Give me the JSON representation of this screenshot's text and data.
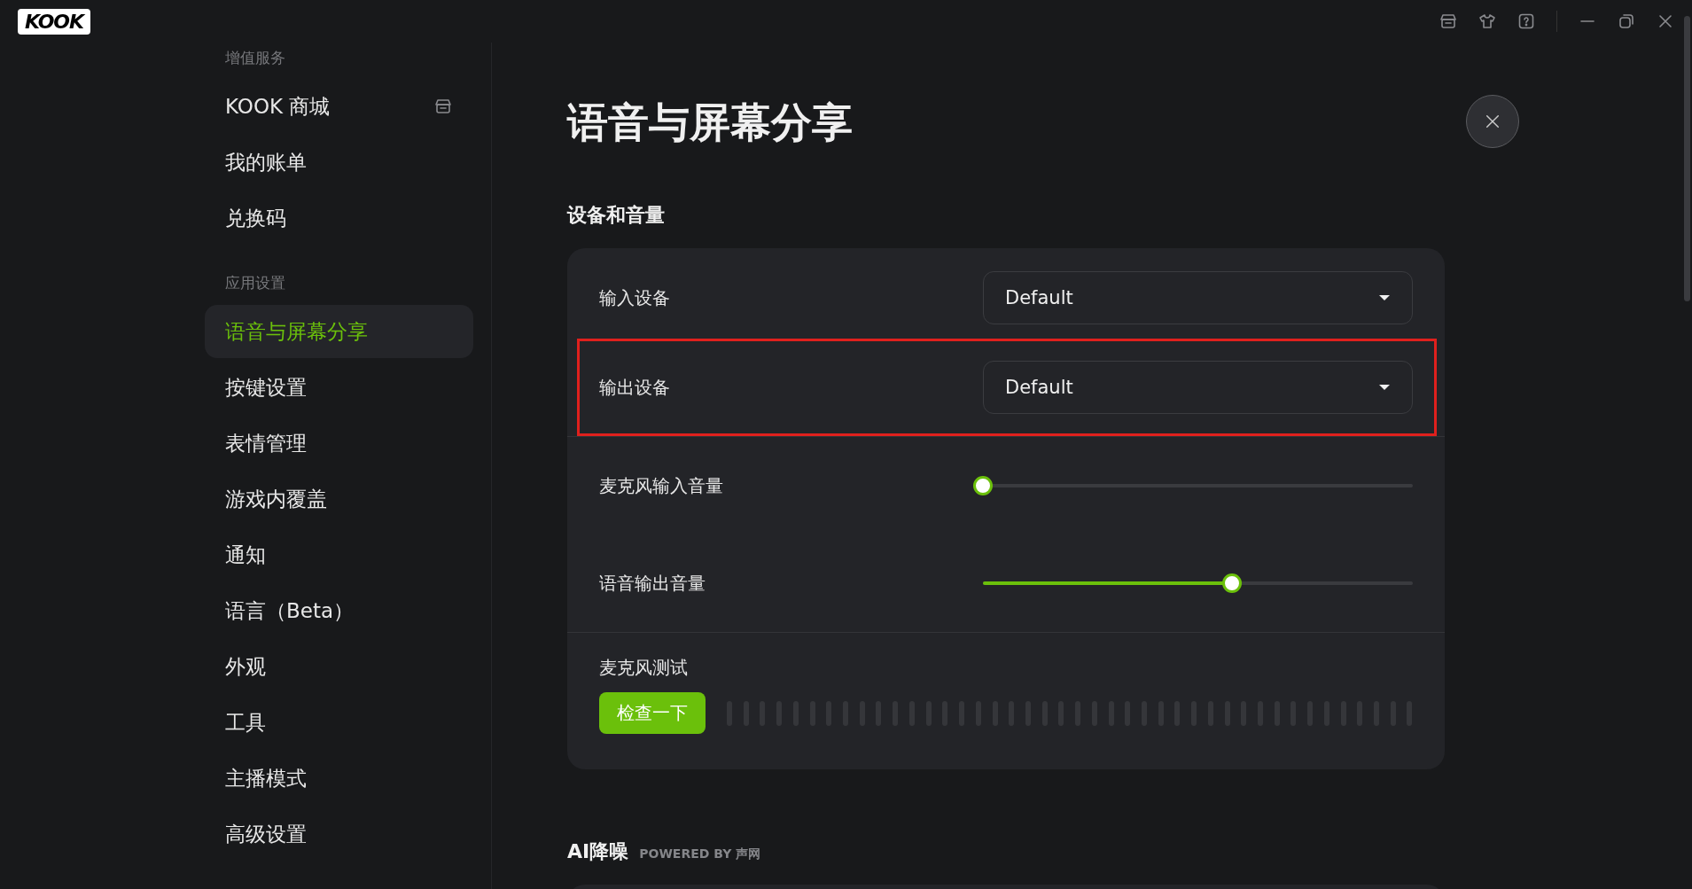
{
  "app": {
    "logo": "KOOK"
  },
  "sidebar": {
    "sections": [
      {
        "heading": "增值服务",
        "items": [
          {
            "label": "KOOK 商城",
            "selected": false,
            "has_icon": true
          },
          {
            "label": "我的账单",
            "selected": false,
            "has_icon": false
          },
          {
            "label": "兑换码",
            "selected": false,
            "has_icon": false
          }
        ]
      },
      {
        "heading": "应用设置",
        "items": [
          {
            "label": "语音与屏幕分享",
            "selected": true,
            "has_icon": false
          },
          {
            "label": "按键设置",
            "selected": false,
            "has_icon": false
          },
          {
            "label": "表情管理",
            "selected": false,
            "has_icon": false
          },
          {
            "label": "游戏内覆盖",
            "selected": false,
            "has_icon": false
          },
          {
            "label": "通知",
            "selected": false,
            "has_icon": false
          },
          {
            "label": "语言（Beta）",
            "selected": false,
            "has_icon": false
          },
          {
            "label": "外观",
            "selected": false,
            "has_icon": false
          },
          {
            "label": "工具",
            "selected": false,
            "has_icon": false
          },
          {
            "label": "主播模式",
            "selected": false,
            "has_icon": false
          },
          {
            "label": "高级设置",
            "selected": false,
            "has_icon": false
          }
        ]
      }
    ]
  },
  "page": {
    "title": "语音与屏幕分享",
    "sections": [
      {
        "heading": "设备和音量",
        "rows": [
          {
            "kind": "dropdown",
            "label": "输入设备",
            "value": "Default",
            "highlighted": false
          },
          {
            "kind": "dropdown",
            "label": "输出设备",
            "value": "Default",
            "highlighted": true
          },
          {
            "kind": "slider",
            "label": "麦克风输入音量",
            "level": 0,
            "highlighted": false
          },
          {
            "kind": "slider",
            "label": "语音输出音量",
            "level": 0.58,
            "highlighted": false
          },
          {
            "kind": "mictest",
            "label": "麦克风测试",
            "button": "检查一下",
            "highlighted": false
          }
        ]
      },
      {
        "heading": "AI降噪",
        "powered_by": "POWERED BY 声网"
      }
    ]
  }
}
